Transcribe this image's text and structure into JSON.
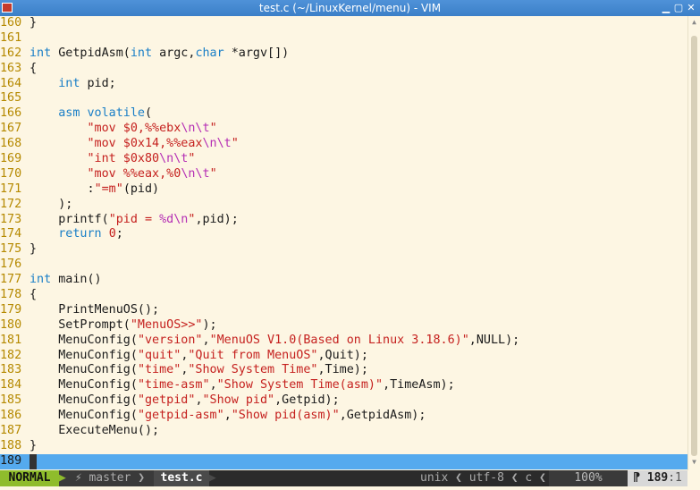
{
  "window": {
    "title": "test.c (~/LinuxKernel/menu) - VIM",
    "min_label": "▁",
    "max_label": "▢",
    "close_label": "✕"
  },
  "editor": {
    "lines": [
      {
        "n": "160",
        "tokens": [
          {
            "t": "}",
            "c": "code"
          }
        ]
      },
      {
        "n": "161",
        "tokens": []
      },
      {
        "n": "162",
        "tokens": [
          {
            "t": "int",
            "c": "kw"
          },
          {
            "t": " GetpidAsm(",
            "c": "code"
          },
          {
            "t": "int",
            "c": "kw"
          },
          {
            "t": " argc,",
            "c": "code"
          },
          {
            "t": "char",
            "c": "kw"
          },
          {
            "t": " *argv[])",
            "c": "code"
          }
        ]
      },
      {
        "n": "163",
        "tokens": [
          {
            "t": "{",
            "c": "code"
          }
        ]
      },
      {
        "n": "164",
        "tokens": [
          {
            "t": "    ",
            "c": "code"
          },
          {
            "t": "int",
            "c": "kw"
          },
          {
            "t": " pid;",
            "c": "code"
          }
        ]
      },
      {
        "n": "165",
        "tokens": []
      },
      {
        "n": "166",
        "tokens": [
          {
            "t": "    ",
            "c": "code"
          },
          {
            "t": "asm",
            "c": "kw"
          },
          {
            "t": " ",
            "c": "code"
          },
          {
            "t": "volatile",
            "c": "kw"
          },
          {
            "t": "(",
            "c": "code"
          }
        ]
      },
      {
        "n": "167",
        "tokens": [
          {
            "t": "        ",
            "c": "code"
          },
          {
            "t": "\"mov $0,%%ebx",
            "c": "st"
          },
          {
            "t": "\\n\\t",
            "c": "es"
          },
          {
            "t": "\"",
            "c": "st"
          }
        ]
      },
      {
        "n": "168",
        "tokens": [
          {
            "t": "        ",
            "c": "code"
          },
          {
            "t": "\"mov $0x14,%%eax",
            "c": "st"
          },
          {
            "t": "\\n\\t",
            "c": "es"
          },
          {
            "t": "\"",
            "c": "st"
          }
        ]
      },
      {
        "n": "169",
        "tokens": [
          {
            "t": "        ",
            "c": "code"
          },
          {
            "t": "\"int $0x80",
            "c": "st"
          },
          {
            "t": "\\n\\t",
            "c": "es"
          },
          {
            "t": "\"",
            "c": "st"
          }
        ]
      },
      {
        "n": "170",
        "tokens": [
          {
            "t": "        ",
            "c": "code"
          },
          {
            "t": "\"mov %%eax,%0",
            "c": "st"
          },
          {
            "t": "\\n\\t",
            "c": "es"
          },
          {
            "t": "\"",
            "c": "st"
          }
        ]
      },
      {
        "n": "171",
        "tokens": [
          {
            "t": "        :",
            "c": "code"
          },
          {
            "t": "\"=m\"",
            "c": "st"
          },
          {
            "t": "(pid)",
            "c": "code"
          }
        ]
      },
      {
        "n": "172",
        "tokens": [
          {
            "t": "    );",
            "c": "code"
          }
        ]
      },
      {
        "n": "173",
        "tokens": [
          {
            "t": "    printf(",
            "c": "code"
          },
          {
            "t": "\"pid = ",
            "c": "st"
          },
          {
            "t": "%d\\n",
            "c": "es"
          },
          {
            "t": "\"",
            "c": "st"
          },
          {
            "t": ",pid);",
            "c": "code"
          }
        ]
      },
      {
        "n": "174",
        "tokens": [
          {
            "t": "    ",
            "c": "code"
          },
          {
            "t": "return",
            "c": "kw"
          },
          {
            "t": " ",
            "c": "code"
          },
          {
            "t": "0",
            "c": "nu"
          },
          {
            "t": ";",
            "c": "code"
          }
        ]
      },
      {
        "n": "175",
        "tokens": [
          {
            "t": "}",
            "c": "code"
          }
        ]
      },
      {
        "n": "176",
        "tokens": []
      },
      {
        "n": "177",
        "tokens": [
          {
            "t": "int",
            "c": "kw"
          },
          {
            "t": " main()",
            "c": "code"
          }
        ]
      },
      {
        "n": "178",
        "tokens": [
          {
            "t": "{",
            "c": "code"
          }
        ]
      },
      {
        "n": "179",
        "tokens": [
          {
            "t": "    PrintMenuOS();",
            "c": "code"
          }
        ]
      },
      {
        "n": "180",
        "tokens": [
          {
            "t": "    SetPrompt(",
            "c": "code"
          },
          {
            "t": "\"MenuOS>>\"",
            "c": "st"
          },
          {
            "t": ");",
            "c": "code"
          }
        ]
      },
      {
        "n": "181",
        "tokens": [
          {
            "t": "    MenuConfig(",
            "c": "code"
          },
          {
            "t": "\"version\"",
            "c": "st"
          },
          {
            "t": ",",
            "c": "code"
          },
          {
            "t": "\"MenuOS V1.0(Based on Linux 3.18.6)\"",
            "c": "st"
          },
          {
            "t": ",NULL);",
            "c": "code"
          }
        ]
      },
      {
        "n": "182",
        "tokens": [
          {
            "t": "    MenuConfig(",
            "c": "code"
          },
          {
            "t": "\"quit\"",
            "c": "st"
          },
          {
            "t": ",",
            "c": "code"
          },
          {
            "t": "\"Quit from MenuOS\"",
            "c": "st"
          },
          {
            "t": ",Quit);",
            "c": "code"
          }
        ]
      },
      {
        "n": "183",
        "tokens": [
          {
            "t": "    MenuConfig(",
            "c": "code"
          },
          {
            "t": "\"time\"",
            "c": "st"
          },
          {
            "t": ",",
            "c": "code"
          },
          {
            "t": "\"Show System Time\"",
            "c": "st"
          },
          {
            "t": ",Time);",
            "c": "code"
          }
        ]
      },
      {
        "n": "184",
        "tokens": [
          {
            "t": "    MenuConfig(",
            "c": "code"
          },
          {
            "t": "\"time-asm\"",
            "c": "st"
          },
          {
            "t": ",",
            "c": "code"
          },
          {
            "t": "\"Show System Time(asm)\"",
            "c": "st"
          },
          {
            "t": ",TimeAsm);",
            "c": "code"
          }
        ]
      },
      {
        "n": "185",
        "tokens": [
          {
            "t": "    MenuConfig(",
            "c": "code"
          },
          {
            "t": "\"getpid\"",
            "c": "st"
          },
          {
            "t": ",",
            "c": "code"
          },
          {
            "t": "\"Show pid\"",
            "c": "st"
          },
          {
            "t": ",Getpid);",
            "c": "code"
          }
        ]
      },
      {
        "n": "186",
        "tokens": [
          {
            "t": "    MenuConfig(",
            "c": "code"
          },
          {
            "t": "\"getpid-asm\"",
            "c": "st"
          },
          {
            "t": ",",
            "c": "code"
          },
          {
            "t": "\"Show pid(asm)\"",
            "c": "st"
          },
          {
            "t": ",GetpidAsm);",
            "c": "code"
          }
        ]
      },
      {
        "n": "187",
        "tokens": [
          {
            "t": "    ExecuteMenu();",
            "c": "code"
          }
        ]
      },
      {
        "n": "188",
        "tokens": [
          {
            "t": "}",
            "c": "code"
          }
        ]
      },
      {
        "n": "189",
        "tokens": [],
        "cursor": true
      }
    ]
  },
  "statusline": {
    "mode": "NORMAL",
    "mode_sep": "▶",
    "branch": " ⚡ master ❯",
    "file": "test.c",
    "file_sep": "▶",
    "fileformat": "unix ❮ utf-8 ❮ c ❮",
    "percent": "100%",
    "position_prefix": "⁋ ",
    "line": "189",
    "col": ":1"
  },
  "colors": {
    "background": "#fdf6e3",
    "keyword": "#1a7fc7",
    "string": "#c5211f",
    "escape": "#b52fb5",
    "line_number": "#b58900",
    "cursorline": "#55aaee",
    "mode_bg": "#8fbc2c"
  }
}
